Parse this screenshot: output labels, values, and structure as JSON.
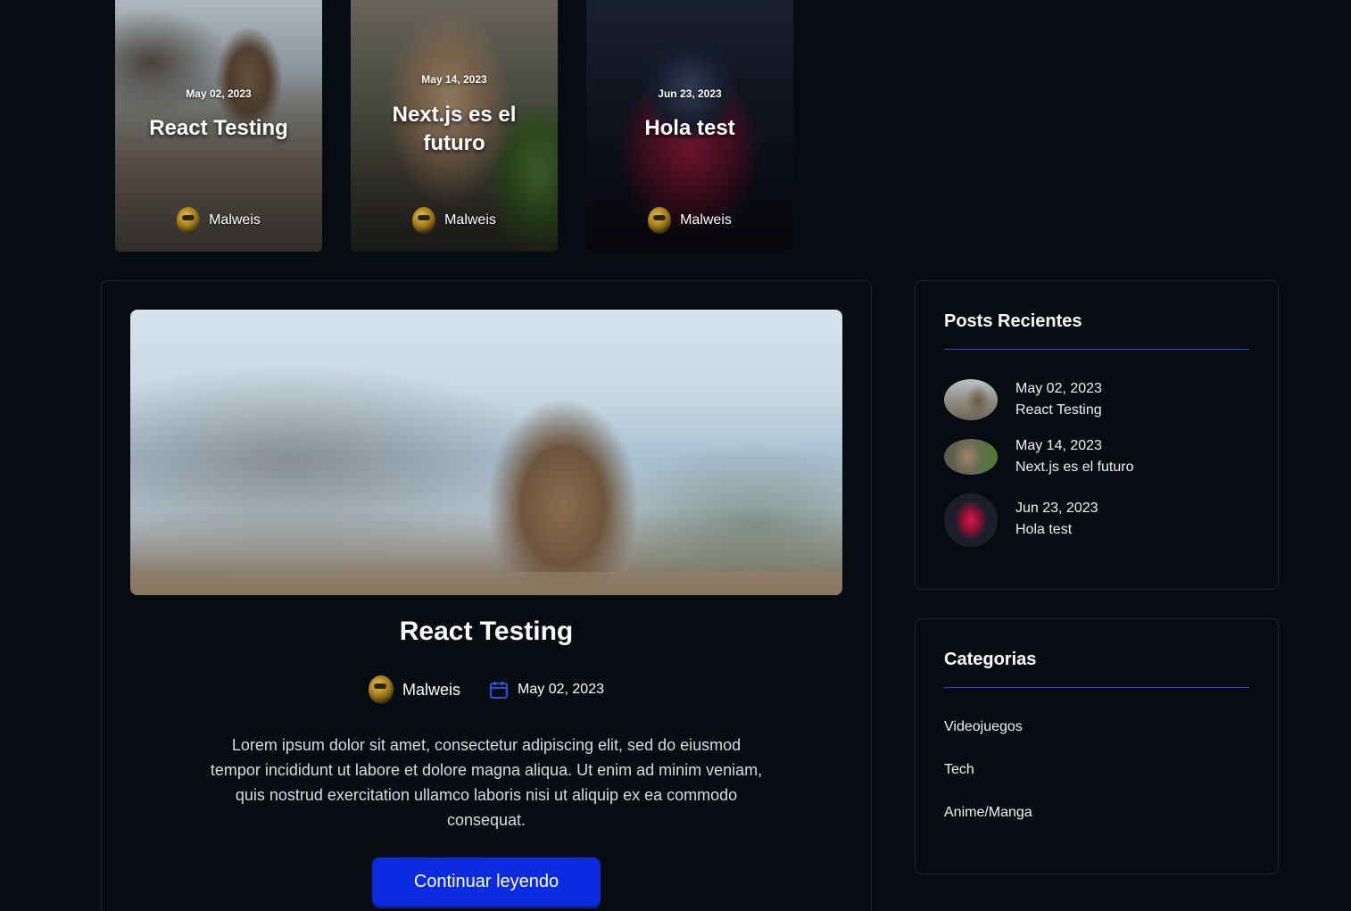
{
  "featured_posts": [
    {
      "date": "May 02, 2023",
      "title": "React Testing",
      "author": "Malweis"
    },
    {
      "date": "May 14, 2023",
      "title": "Next.js es el futuro",
      "author": "Malweis"
    },
    {
      "date": "Jun 23, 2023",
      "title": "Hola test",
      "author": "Malweis"
    }
  ],
  "main_post": {
    "title": "React Testing",
    "author": "Malweis",
    "date": "May 02, 2023",
    "excerpt": "Lorem ipsum dolor sit amet, consectetur adipiscing elit, sed do eiusmod tempor incididunt ut labore et dolore magna aliqua. Ut enim ad minim veniam, quis nostrud exercitation ullamco laboris nisi ut aliquip ex ea commodo consequat.",
    "read_more_label": "Continuar leyendo"
  },
  "recent_posts": {
    "title": "Posts Recientes",
    "items": [
      {
        "date": "May 02, 2023",
        "title": "React Testing"
      },
      {
        "date": "May 14, 2023",
        "title": "Next.js es el futuro"
      },
      {
        "date": "Jun 23, 2023",
        "title": "Hola test"
      }
    ]
  },
  "categories": {
    "title": "Categorias",
    "items": [
      "Videojuegos",
      "Tech",
      "Anime/Manga"
    ]
  },
  "colors": {
    "background": "#070b12",
    "accent": "#0b2be0",
    "divider": "#1d47d8",
    "border": "#1f2733"
  }
}
